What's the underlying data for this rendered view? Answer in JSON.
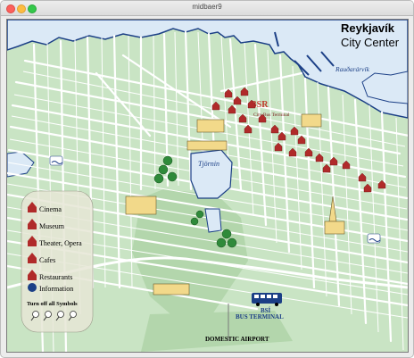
{
  "window": {
    "title": "midbaer9"
  },
  "map": {
    "title_line1": "Reykjavík",
    "title_line2": "City Center",
    "labels": {
      "bay": "Rauðarárvík",
      "pond": "Tjörnin",
      "bsr_logo": "BSR",
      "city_bus_terminal": "City Bus Terminal",
      "bsi": "BSÍ",
      "bus_terminal": "BUS TERMINAL",
      "domestic_airport": "DOMESTIC AIRPORT"
    },
    "colors": {
      "sea": "#dbe9f6",
      "land": "#c9e4c4",
      "park": "#b3d6ac",
      "streets": "#ffffff",
      "pond": "#dbe9f6",
      "coast": "#1b3f86"
    }
  },
  "legend": {
    "items": [
      {
        "label": "Cinema",
        "icon": "cinema-icon"
      },
      {
        "label": "Museum",
        "icon": "museum-icon"
      },
      {
        "label": "Theater, Opera",
        "icon": "theater-icon"
      },
      {
        "label": "Cafes",
        "icon": "cafe-icon"
      },
      {
        "label": "Restaurants",
        "icon": "restaurant-icon"
      },
      {
        "label": "Information",
        "icon": "information-icon"
      }
    ],
    "turn_off_label": "Turn off all Symbols"
  }
}
